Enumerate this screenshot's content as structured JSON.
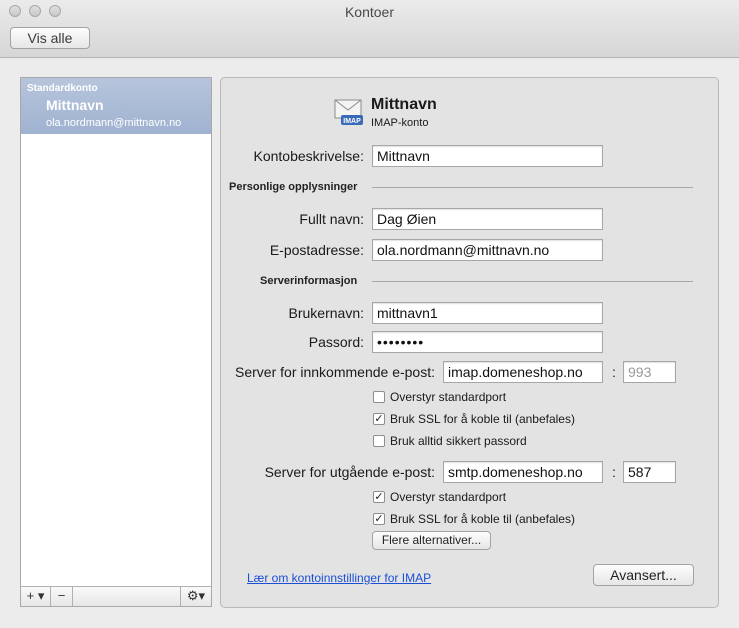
{
  "window": {
    "title": "Kontoer"
  },
  "toolbar": {
    "show_all_label": "Vis alle"
  },
  "sidebar": {
    "group_label": "Standardkonto",
    "account_name": "Mittnavn",
    "account_email": "ola.nordmann@mittnavn.no",
    "add_label": "+ ▾",
    "remove_label": "−",
    "gear_label": "⚙▾"
  },
  "account": {
    "icon_badge": "IMAP",
    "name": "Mittnavn",
    "type": "IMAP-konto",
    "description_label": "Kontobeskrivelse:",
    "description_value": "Mittnavn"
  },
  "personal": {
    "section_label": "Personlige opplysninger",
    "fullname_label": "Fullt navn:",
    "fullname_value": "Dag Øien",
    "email_label": "E-postadresse:",
    "email_value": "ola.nordmann@mittnavn.no"
  },
  "server": {
    "section_label": "Serverinformasjon",
    "username_label": "Brukernavn:",
    "username_value": "mittnavn1",
    "password_label": "Passord:",
    "password_value": "••••••••",
    "incoming_label": "Server for innkommende e-post:",
    "incoming_value": "imap.domeneshop.no",
    "incoming_port": "993",
    "incoming_override_label": "Overstyr standardport",
    "incoming_ssl_label": "Bruk SSL for å koble til (anbefales)",
    "incoming_secure_pw_label": "Bruk alltid sikkert passord",
    "outgoing_label": "Server for utgående e-post:",
    "outgoing_value": "smtp.domeneshop.no",
    "outgoing_port": "587",
    "outgoing_override_label": "Overstyr standardport",
    "outgoing_ssl_label": "Bruk SSL for å koble til (anbefales)",
    "more_options_label": "Flere alternativer...",
    "colon": ":"
  },
  "footer": {
    "help_link": "Lær om kontoinnstillinger for IMAP",
    "advanced_label": "Avansert..."
  },
  "checks": {
    "checked": "✓"
  }
}
